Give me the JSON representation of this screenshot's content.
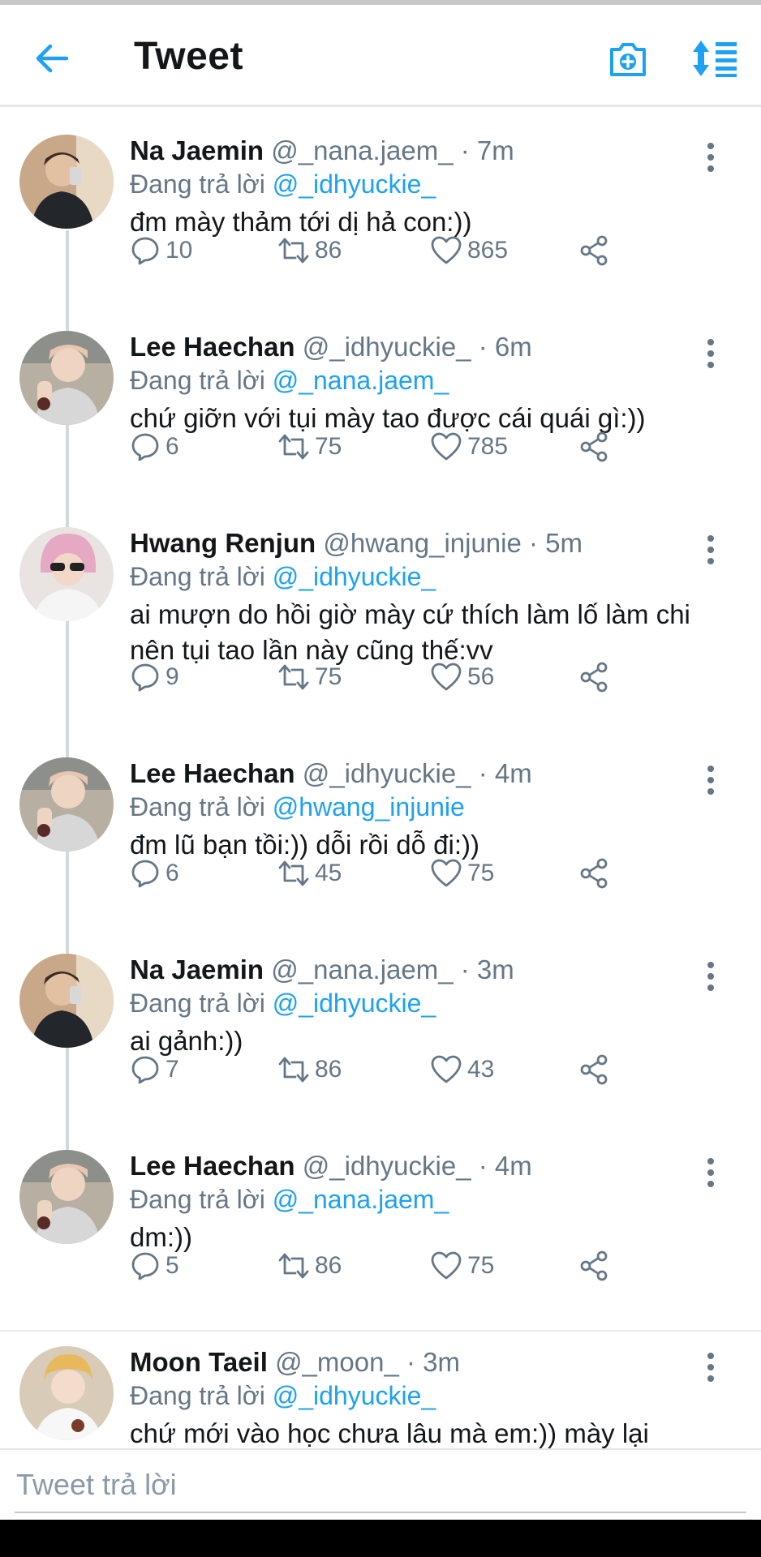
{
  "header": {
    "title": "Tweet"
  },
  "colors": {
    "accent": "#1da1f2",
    "secondary_text": "#657786",
    "primary_text": "#14171a"
  },
  "icons": {
    "back": "arrow-left-icon",
    "camera": "camera-icon",
    "sort": "sort-icon",
    "more": "more-vertical-icon",
    "reply": "reply-icon",
    "retweet": "retweet-icon",
    "like": "heart-icon",
    "share": "share-icon"
  },
  "reply_prefix": "Đang trả lời",
  "tweets": [
    {
      "name": "Na Jaemin",
      "meta": "@_nana.jaem_ · 7m",
      "reply_to": "@_idhyuckie_",
      "text": "đm mày thảm tới dị hả con:))",
      "replies": "10",
      "retweets": "86",
      "likes": "865"
    },
    {
      "name": "Lee Haechan",
      "meta": "@_idhyuckie_ · 6m",
      "reply_to": "@_nana.jaem_",
      "text": "chứ giỡn với tụi mày tao được cái quái gì:))",
      "replies": "6",
      "retweets": "75",
      "likes": "785"
    },
    {
      "name": "Hwang Renjun",
      "meta": "@hwang_injunie · 5m",
      "reply_to": "@_idhyuckie_",
      "text": "ai mượn do hồi giờ mày cứ thích làm lố làm chi nên tụi tao lần này cũng thế:vv",
      "replies": "9",
      "retweets": "75",
      "likes": "56"
    },
    {
      "name": "Lee Haechan",
      "meta": "@_idhyuckie_ · 4m",
      "reply_to": "@hwang_injunie",
      "text": "đm lũ bạn tồi:)) dỗi rồi dỗ đi:))",
      "replies": "6",
      "retweets": "45",
      "likes": "75"
    },
    {
      "name": "Na Jaemin",
      "meta": "@_nana.jaem_ · 3m",
      "reply_to": "@_idhyuckie_",
      "text": "ai gảnh:))",
      "replies": "7",
      "retweets": "86",
      "likes": "43"
    },
    {
      "name": "Lee Haechan",
      "meta": "@_idhyuckie_ · 4m",
      "reply_to": "@_nana.jaem_",
      "text": "dm:))",
      "replies": "5",
      "retweets": "86",
      "likes": "75"
    },
    {
      "name": "Moon Taeil",
      "meta": "@_moon_ · 3m",
      "reply_to": "@_idhyuckie_",
      "text": "chứ mới vào học chưa lâu mà em:)) mày lại"
    }
  ],
  "compose": {
    "placeholder": "Tweet trả lời"
  }
}
